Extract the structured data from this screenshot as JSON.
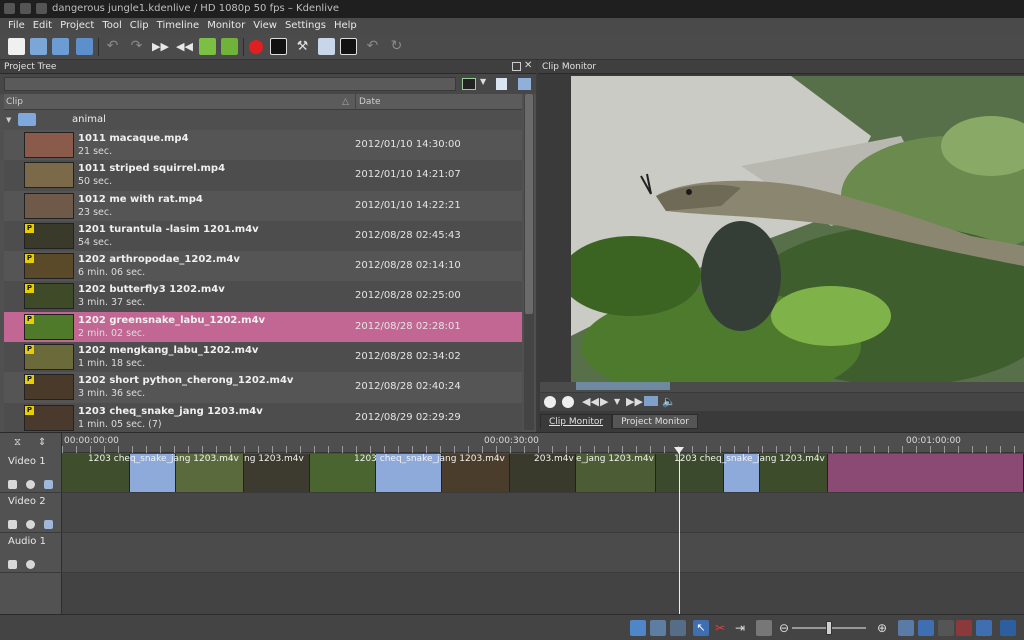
{
  "window": {
    "title": "dangerous jungle1.kdenlive / HD 1080p 50 fps – Kdenlive"
  },
  "menu": [
    "File",
    "Edit",
    "Project",
    "Tool",
    "Clip",
    "Timeline",
    "Monitor",
    "View",
    "Settings",
    "Help"
  ],
  "toolbar": {
    "icons": [
      "new-icon",
      "open-icon",
      "open-recent-icon",
      "save-icon",
      "undo-icon",
      "redo-icon",
      "forward-icon",
      "rewind-icon",
      "next-edit-icon",
      "prev-edit-icon",
      "record-icon",
      "add-text-icon",
      "tools-icon",
      "bookmark-icon",
      "add-clip-icon",
      "undo2-icon",
      "redo2-icon"
    ]
  },
  "project_tree": {
    "title": "Project Tree",
    "columns": {
      "clip": "Clip",
      "date": "Date"
    },
    "folder": "animal",
    "clips": [
      {
        "name": "1011 macaque.mp4",
        "duration": "21 sec.",
        "date": "2012/01/10 14:30:00",
        "proxy": false,
        "selected": false
      },
      {
        "name": "1011 striped squirrel.mp4",
        "duration": "50 sec.",
        "date": "2012/01/10 14:21:07",
        "proxy": false,
        "selected": false
      },
      {
        "name": "1012 me with rat.mp4",
        "duration": "23 sec.",
        "date": "2012/01/10 14:22:21",
        "proxy": false,
        "selected": false
      },
      {
        "name": "1201 turantula -lasim 1201.m4v",
        "duration": "54 sec.",
        "date": "2012/08/28 02:45:43",
        "proxy": true,
        "selected": false
      },
      {
        "name": "1202 arthropodae_1202.m4v",
        "duration": "6 min. 06 sec.",
        "date": "2012/08/28 02:14:10",
        "proxy": true,
        "selected": false
      },
      {
        "name": "1202 butterfly3 1202.m4v",
        "duration": "3 min. 37 sec.",
        "date": "2012/08/28 02:25:00",
        "proxy": true,
        "selected": false
      },
      {
        "name": "1202 greensnake_labu_1202.m4v",
        "duration": "2 min. 02 sec.",
        "date": "2012/08/28 02:28:01",
        "proxy": true,
        "selected": true
      },
      {
        "name": "1202 mengkang_labu_1202.m4v",
        "duration": "1 min. 18 sec.",
        "date": "2012/08/28 02:34:02",
        "proxy": true,
        "selected": false
      },
      {
        "name": "1202 short python_cherong_1202.m4v",
        "duration": "3 min. 36 sec.",
        "date": "2012/08/28 02:40:24",
        "proxy": true,
        "selected": false
      },
      {
        "name": "1203 cheq_snake_jang 1203.m4v",
        "duration": "1 min. 05 sec. (7)",
        "date": "2012/08/29 02:29:29",
        "proxy": true,
        "selected": false
      }
    ]
  },
  "monitor": {
    "title": "Clip Monitor",
    "tabs": [
      "Clip Monitor",
      "Project Monitor"
    ],
    "active_tab": 0
  },
  "timeline": {
    "ruler": [
      "00:00:00:00",
      "00:00:30:00",
      "00:01:00:00"
    ],
    "tracks": [
      "Video 1",
      "Video 2",
      "Audio 1"
    ],
    "clip_labels": [
      "1203 cheq_snake_jang 1203.m4v",
      "ng 1203.m4v",
      "1203 cheq_snake_jang 1203.m4v",
      "203.m4v",
      "e_jang 1203.m4v",
      "1203 cheq_snake_jang 1203.m4v"
    ]
  },
  "colors": {
    "selection": "#c26794",
    "accent": "#6f8aa0"
  }
}
